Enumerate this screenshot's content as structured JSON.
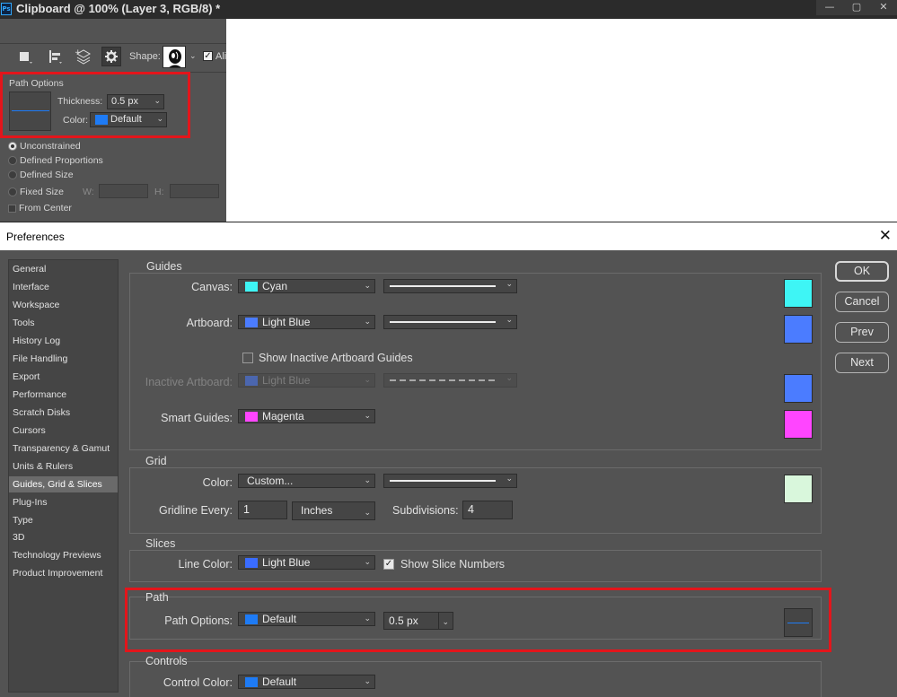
{
  "ps_window": {
    "title": "Clipboard @ 100% (Layer 3, RGB/8) *",
    "logo": "Ps",
    "window_controls": [
      "—",
      "▢",
      "✕"
    ],
    "options_bar": {
      "shape_label": "Shape:",
      "align_label": "Ali"
    },
    "path_options_popup": {
      "title": "Path Options",
      "thickness_label": "Thickness:",
      "thickness_value": "0.5 px",
      "color_label": "Color:",
      "color_value": "Default",
      "color_swatch": "#1e7bf5",
      "constraints": [
        "Unconstrained",
        "Defined Proportions",
        "Defined Size",
        "Fixed Size"
      ],
      "selected_constraint": "Unconstrained",
      "w_label": "W:",
      "h_label": "H:",
      "from_center_label": "From Center"
    }
  },
  "preferences": {
    "title": "Preferences",
    "close_icon": "✕",
    "nav_items": [
      "General",
      "Interface",
      "Workspace",
      "Tools",
      "History Log",
      "File Handling",
      "Export",
      "Performance",
      "Scratch Disks",
      "Cursors",
      "Transparency & Gamut",
      "Units & Rulers",
      "Guides, Grid & Slices",
      "Plug-Ins",
      "Type",
      "3D",
      "Technology Previews",
      "Product Improvement"
    ],
    "selected_nav": "Guides, Grid & Slices",
    "buttons": {
      "ok": "OK",
      "cancel": "Cancel",
      "prev": "Prev",
      "next": "Next"
    },
    "guides": {
      "title": "Guides",
      "canvas_label": "Canvas:",
      "canvas_color": "Cyan",
      "canvas_swatch": "#3ef5f5",
      "artboard_label": "Artboard:",
      "artboard_color": "Light Blue",
      "artboard_swatch": "#4b7cff",
      "show_inactive_label": "Show Inactive Artboard Guides",
      "show_inactive_checked": false,
      "inactive_label": "Inactive Artboard:",
      "inactive_color": "Light Blue",
      "inactive_swatch": "#4b7cff",
      "smart_label": "Smart Guides:",
      "smart_color": "Magenta",
      "smart_swatch": "#ff45ff"
    },
    "grid": {
      "title": "Grid",
      "color_label": "Color:",
      "color_value": "Custom...",
      "color_swatch": "#d9f7dc",
      "gridline_label": "Gridline Every:",
      "gridline_value": "1",
      "units_value": "Inches",
      "subdivisions_label": "Subdivisions:",
      "subdivisions_value": "4"
    },
    "slices": {
      "title": "Slices",
      "line_color_label": "Line Color:",
      "line_color_value": "Light Blue",
      "line_color_swatch": "#3a6cff",
      "show_numbers_label": "Show Slice Numbers",
      "show_numbers_checked": true
    },
    "path": {
      "title": "Path",
      "options_label": "Path Options:",
      "options_color": "Default",
      "options_swatch": "#1e7bf5",
      "thickness_value": "0.5 px"
    },
    "controls": {
      "title": "Controls",
      "color_label": "Control Color:",
      "color_value": "Default",
      "color_swatch": "#1e7bf5"
    }
  }
}
